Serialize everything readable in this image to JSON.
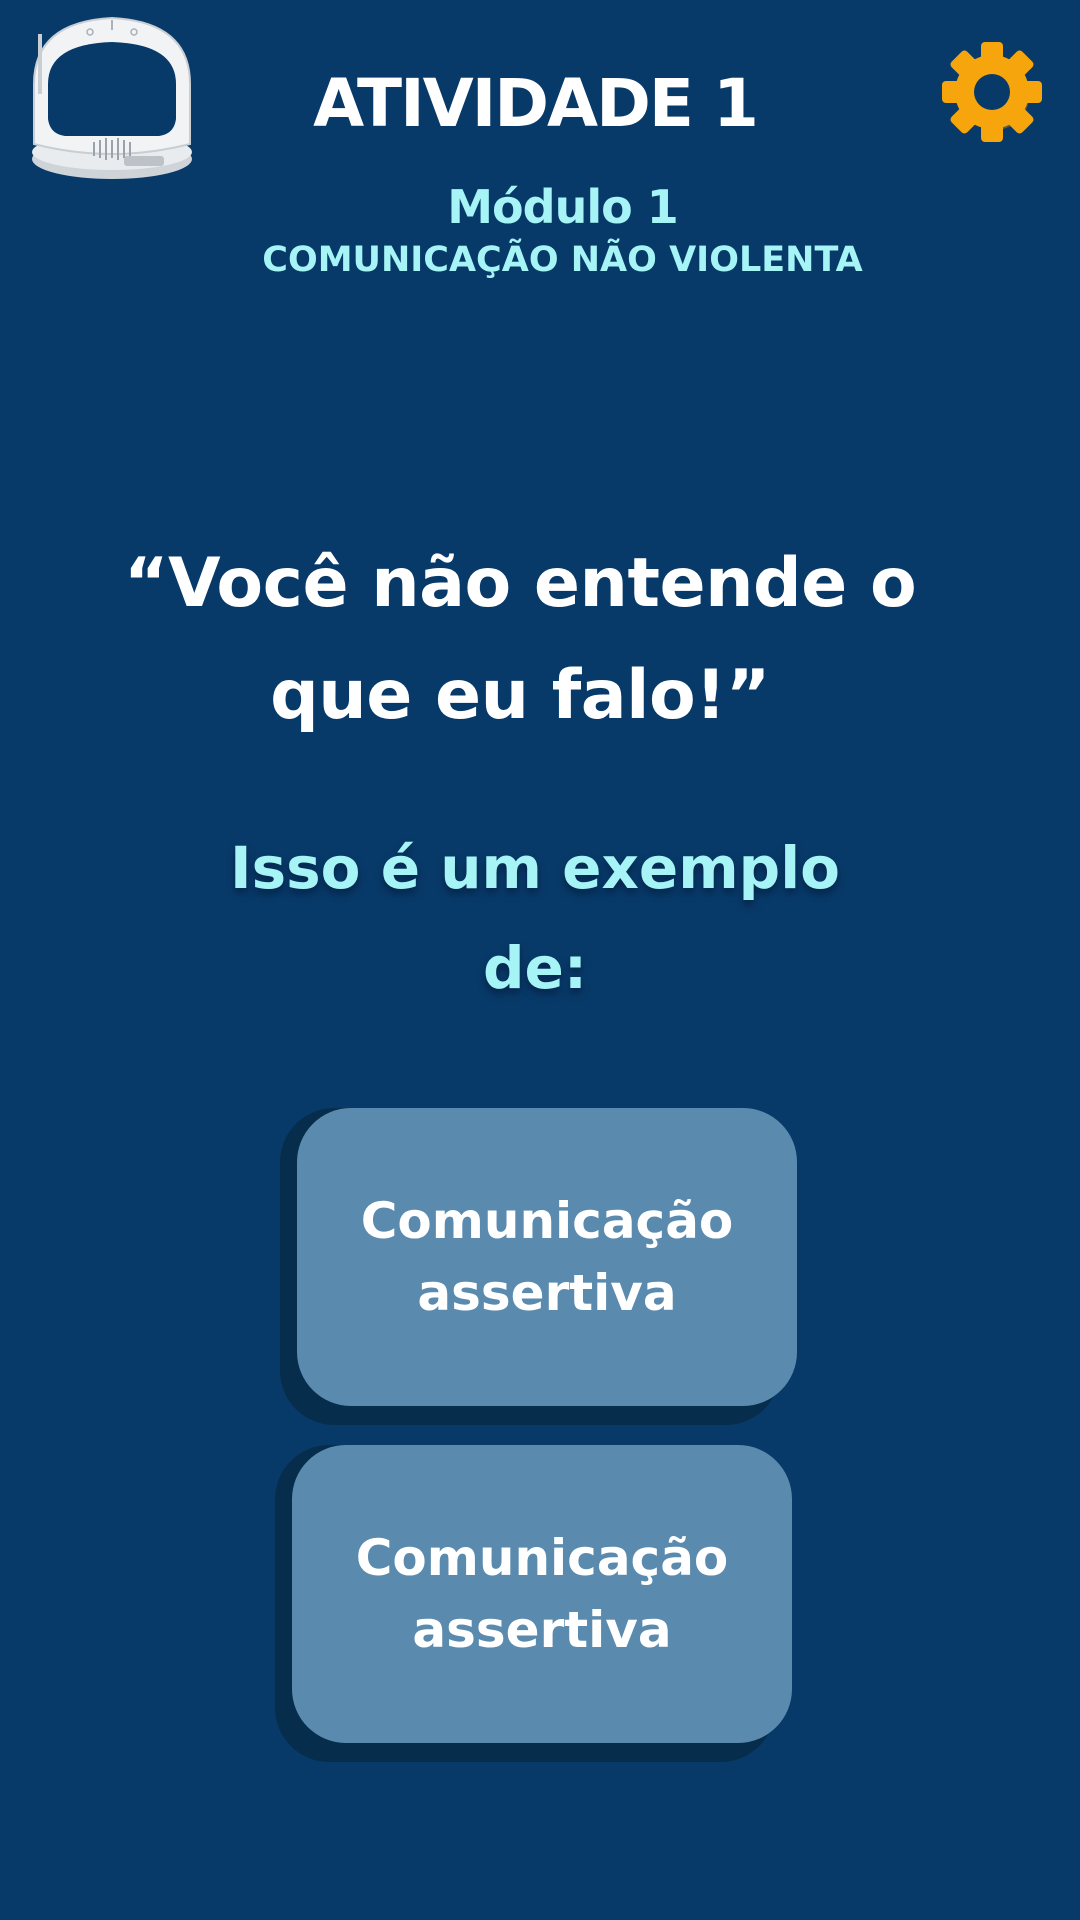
{
  "header": {
    "title": "ATIVIDADE 1",
    "module_name": "Módulo 1",
    "module_subtitle": "COMUNICAÇÃO NÃO VIOLENTA",
    "settings_icon": "gear-icon",
    "mascot_icon": "astronaut-helmet-icon"
  },
  "question": {
    "quote": "“Você não entende o que eu falo!”",
    "prompt": "Isso é um exemplo de:"
  },
  "answers": [
    {
      "label": "Comunicação assertiva"
    },
    {
      "label": "Comunicação assertiva"
    }
  ],
  "colors": {
    "background": "#083a69",
    "accent_text": "#a6f4f6",
    "button_fill": "#5a8aad",
    "button_shadow": "#072d4c",
    "settings_icon": "#f7a50c"
  }
}
